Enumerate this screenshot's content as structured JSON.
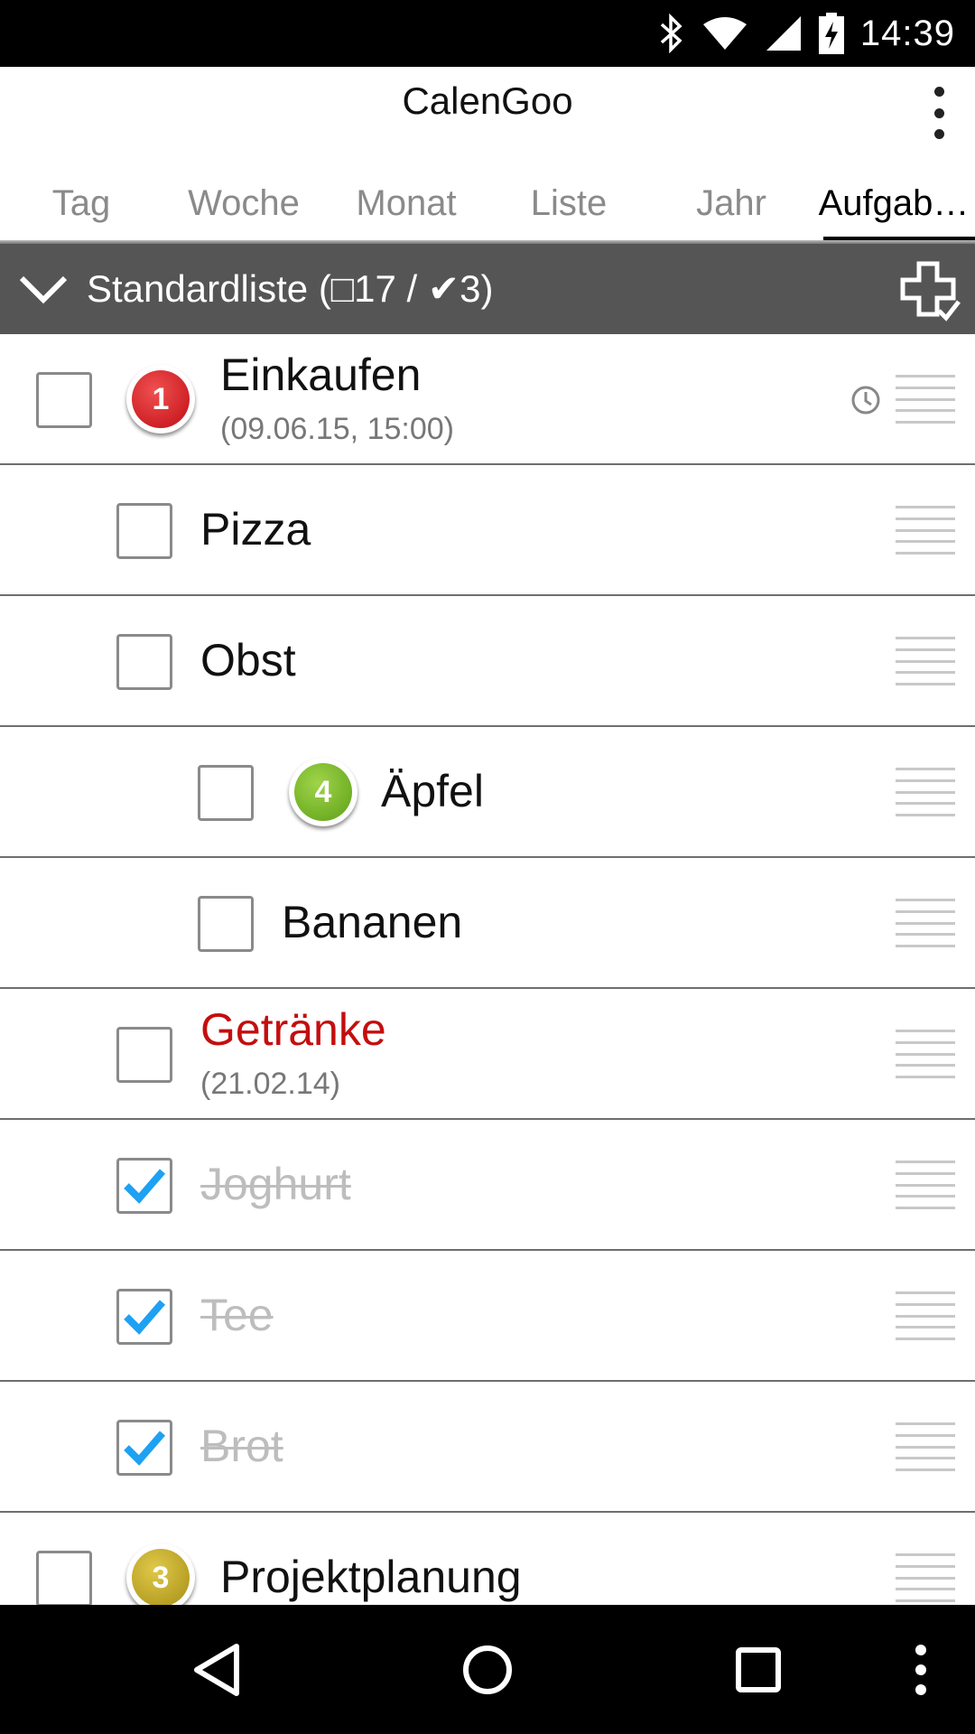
{
  "status_bar": {
    "time": "14:39",
    "icons": [
      "bluetooth-icon",
      "wifi-icon",
      "cell-signal-icon",
      "battery-charging-icon"
    ]
  },
  "app_bar": {
    "title": "CalenGoo",
    "overflow_icon": "overflow-menu-icon"
  },
  "tabs": [
    {
      "label": "Tag",
      "active": false
    },
    {
      "label": "Woche",
      "active": false
    },
    {
      "label": "Monat",
      "active": false
    },
    {
      "label": "Liste",
      "active": false
    },
    {
      "label": "Jahr",
      "active": false
    },
    {
      "label": "Aufgab…",
      "active": true
    }
  ],
  "list_header": {
    "title": "Standardliste (□17 / ✔3)",
    "collapse_icon": "chevron-down-icon",
    "add_icon": "add-task-icon"
  },
  "tasks": [
    {
      "title": "Einkaufen",
      "subtitle": "(09.06.15, 15:00)",
      "checked": false,
      "priority": "1",
      "priority_color": "#d0111a",
      "has_reminder": true,
      "indent": 0
    },
    {
      "title": "Pizza",
      "checked": false,
      "indent": 1
    },
    {
      "title": "Obst",
      "checked": false,
      "indent": 1
    },
    {
      "title": "Äpfel",
      "checked": false,
      "priority": "4",
      "priority_color": "#6fb323",
      "indent": 2
    },
    {
      "title": "Bananen",
      "checked": false,
      "indent": 2
    },
    {
      "title": "Getränke",
      "subtitle": "(21.02.14)",
      "checked": false,
      "overdue": true,
      "indent": 1
    },
    {
      "title": "Joghurt",
      "checked": true,
      "indent": 1
    },
    {
      "title": "Tee",
      "checked": true,
      "indent": 1
    },
    {
      "title": "Brot",
      "checked": true,
      "indent": 1
    },
    {
      "title": "Projektplanung",
      "checked": false,
      "priority": "3",
      "priority_color": "#b8a11f",
      "indent": 0
    }
  ],
  "colors": {
    "overdue_text": "#c40e0e",
    "check_mark": "#1ea1f2",
    "header_bg": "#555555"
  },
  "nav_bar": {
    "icons": [
      "back-icon",
      "home-icon",
      "recents-icon",
      "more-icon"
    ]
  }
}
